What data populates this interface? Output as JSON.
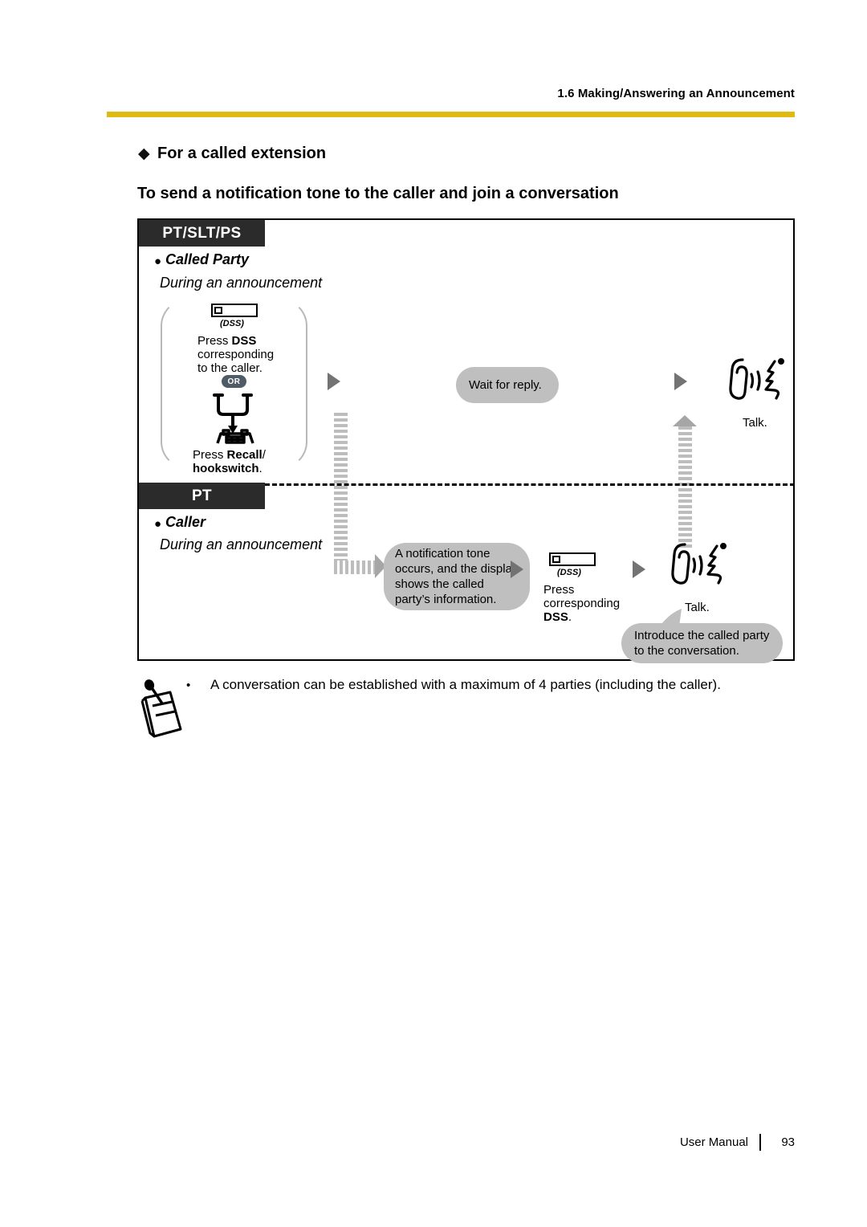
{
  "header": {
    "section_title": "1.6 Making/Answering an Announcement",
    "rule_color": "#DFBB12"
  },
  "headings": {
    "diamond_glyph": "◆",
    "topic": "For a called extension",
    "task": "To send a notification tone to the caller and join a conversation"
  },
  "diagram": {
    "rows": [
      {
        "mode": "PT/SLT/PS",
        "party_bullet": "●",
        "party": "Called Party",
        "state": "During an announcement",
        "steps": {
          "dss_caption": "(DSS)",
          "press_dss_line1_prefix": "Press ",
          "press_dss_line1_bold": "DSS",
          "press_dss_line2": "corresponding",
          "press_dss_line3": "to the caller.",
          "or_badge": "OR",
          "recall_prefix": "Press ",
          "recall_bold": "Recall",
          "recall_suffix": "/",
          "hookswitch_bold": "hookswitch",
          "hookswitch_suffix": ".",
          "wait_callout": "Wait for reply.",
          "talk_caption": "Talk."
        }
      },
      {
        "mode": "PT",
        "party_bullet": "●",
        "party": "Caller",
        "state": "During an announcement",
        "steps": {
          "notification_callout": "A notification tone occurs, and the display shows the called party’s information.",
          "dss_caption": "(DSS)",
          "press_line1": "Press",
          "press_line2": "corresponding",
          "press_line3_bold": "DSS",
          "press_line3_suffix": ".",
          "talk_caption": "Talk.",
          "introduce_callout": "Introduce the called party to the conversation."
        }
      }
    ]
  },
  "note": {
    "bullet": "•",
    "text": "A conversation can be established with a maximum of 4 parties (including the caller)."
  },
  "footer": {
    "manual": "User Manual",
    "page": "93"
  }
}
